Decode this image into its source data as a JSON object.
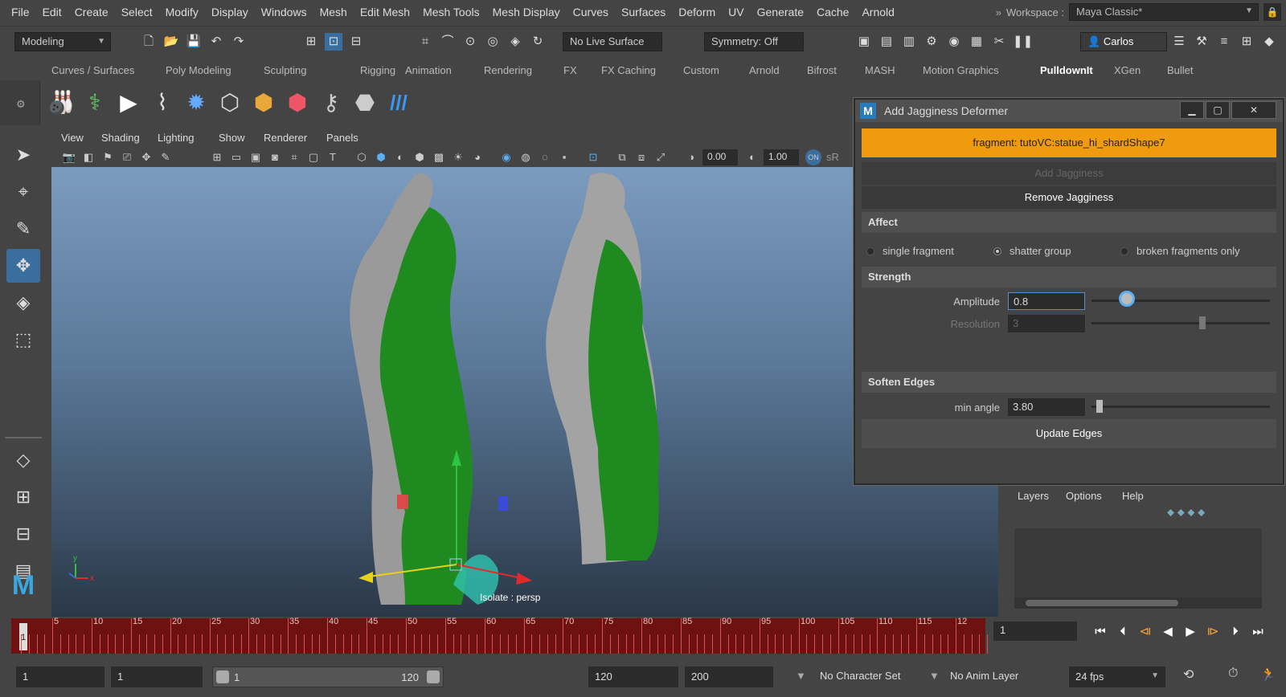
{
  "menu": [
    "File",
    "Edit",
    "Create",
    "Select",
    "Modify",
    "Display",
    "Windows",
    "Mesh",
    "Edit Mesh",
    "Mesh Tools",
    "Mesh Display",
    "Curves",
    "Surfaces",
    "Deform",
    "UV",
    "Generate",
    "Cache",
    "Arnold"
  ],
  "workspace": {
    "label": "Workspace :",
    "value": "Maya Classic*",
    "chevrons": "»"
  },
  "statusline": {
    "mode": "Modeling",
    "live_surface": "No Live Surface",
    "symmetry": "Symmetry: Off",
    "user": "Carlos"
  },
  "shelf_tabs": [
    "Curves / Surfaces",
    "Poly Modeling",
    "Sculpting",
    "Rigging",
    "Animation",
    "Rendering",
    "FX",
    "FX Caching",
    "Custom",
    "Arnold",
    "Bifrost",
    "MASH",
    "Motion Graphics",
    "PulldownIt",
    "XGen",
    "Bullet"
  ],
  "active_shelf_tab": "PulldownIt",
  "panel_menu": [
    "View",
    "Shading",
    "Lighting",
    "Show",
    "Renderer",
    "Panels"
  ],
  "panel_toolbar": {
    "val1": "0.00",
    "val2": "1.00",
    "srgb": "sR"
  },
  "viewport": {
    "label": "Isolate : persp",
    "axis_y": "y",
    "axis_x": "x"
  },
  "dialog": {
    "title": "Add Jagginess Deformer",
    "fragment": "fragment: tutoVC:statue_hi_shardShape7",
    "add_btn": "Add Jagginess",
    "remove_btn": "Remove Jagginess",
    "affect_header": "Affect",
    "affect_options": [
      "single fragment",
      "shatter group",
      "broken fragments only"
    ],
    "affect_selected": 1,
    "strength_header": "Strength",
    "amplitude_label": "Amplitude",
    "amplitude_value": "0.8",
    "resolution_label": "Resolution",
    "resolution_value": "3",
    "soften_header": "Soften Edges",
    "min_angle_label": "min angle",
    "min_angle_value": "3.80",
    "update_btn": "Update Edges"
  },
  "outliner": {
    "menu": [
      "Layers",
      "Options",
      "Help"
    ]
  },
  "timeline": {
    "ticks": [
      "5",
      "10",
      "15",
      "20",
      "25",
      "30",
      "35",
      "40",
      "45",
      "50",
      "55",
      "60",
      "65",
      "70",
      "75",
      "80",
      "85",
      "90",
      "95",
      "100",
      "105",
      "110",
      "115",
      "12"
    ],
    "start_marker": "1",
    "current_frame": "1"
  },
  "range": {
    "start": "1",
    "start2": "1",
    "slider_start": "1",
    "slider_end": "120",
    "end": "120",
    "end2": "200",
    "char_set": "No Character Set",
    "anim_layer": "No Anim Layer",
    "fps": "24 fps"
  },
  "colors": {
    "accent_orange": "#f09a0e",
    "viewport_top": "#7b9bbf",
    "timeline_red": "#6e1111",
    "fragment_green": "#1f8a1f"
  }
}
